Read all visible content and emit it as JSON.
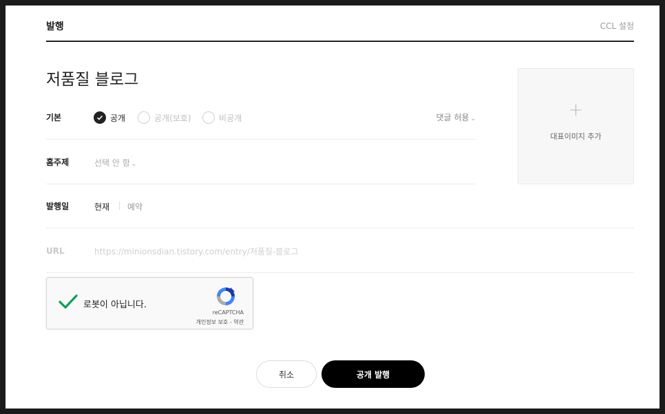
{
  "header": {
    "title": "발행",
    "ccl_label": "CCL 설정"
  },
  "post": {
    "title": "저품질 블로그"
  },
  "visibility": {
    "label": "기본",
    "options": [
      {
        "label": "공개",
        "checked": true
      },
      {
        "label": "공개(보호)",
        "checked": false
      },
      {
        "label": "비공개",
        "checked": false
      }
    ],
    "comment_label": "댓글 허용"
  },
  "topic": {
    "label": "홈주제",
    "value": "선택 안 함"
  },
  "publish_date": {
    "label": "발행일",
    "now_label": "현재",
    "reserve_label": "예약"
  },
  "url": {
    "label": "URL",
    "value": "https://minionsdian.tistory.com/entry/저품질-블로그"
  },
  "thumbnail": {
    "plus": "+",
    "label": "대표이미지 추가"
  },
  "recaptcha": {
    "label": "로봇이 아닙니다.",
    "brand": "reCAPTCHA",
    "terms": "개인정보 보호 - 약관",
    "check_color": "#0f9d58"
  },
  "buttons": {
    "cancel": "취소",
    "publish": "공개 발행"
  },
  "icons": {
    "chevron": "chevron-down-icon",
    "check": "check-icon",
    "recaptcha": "recaptcha-logo-icon"
  }
}
